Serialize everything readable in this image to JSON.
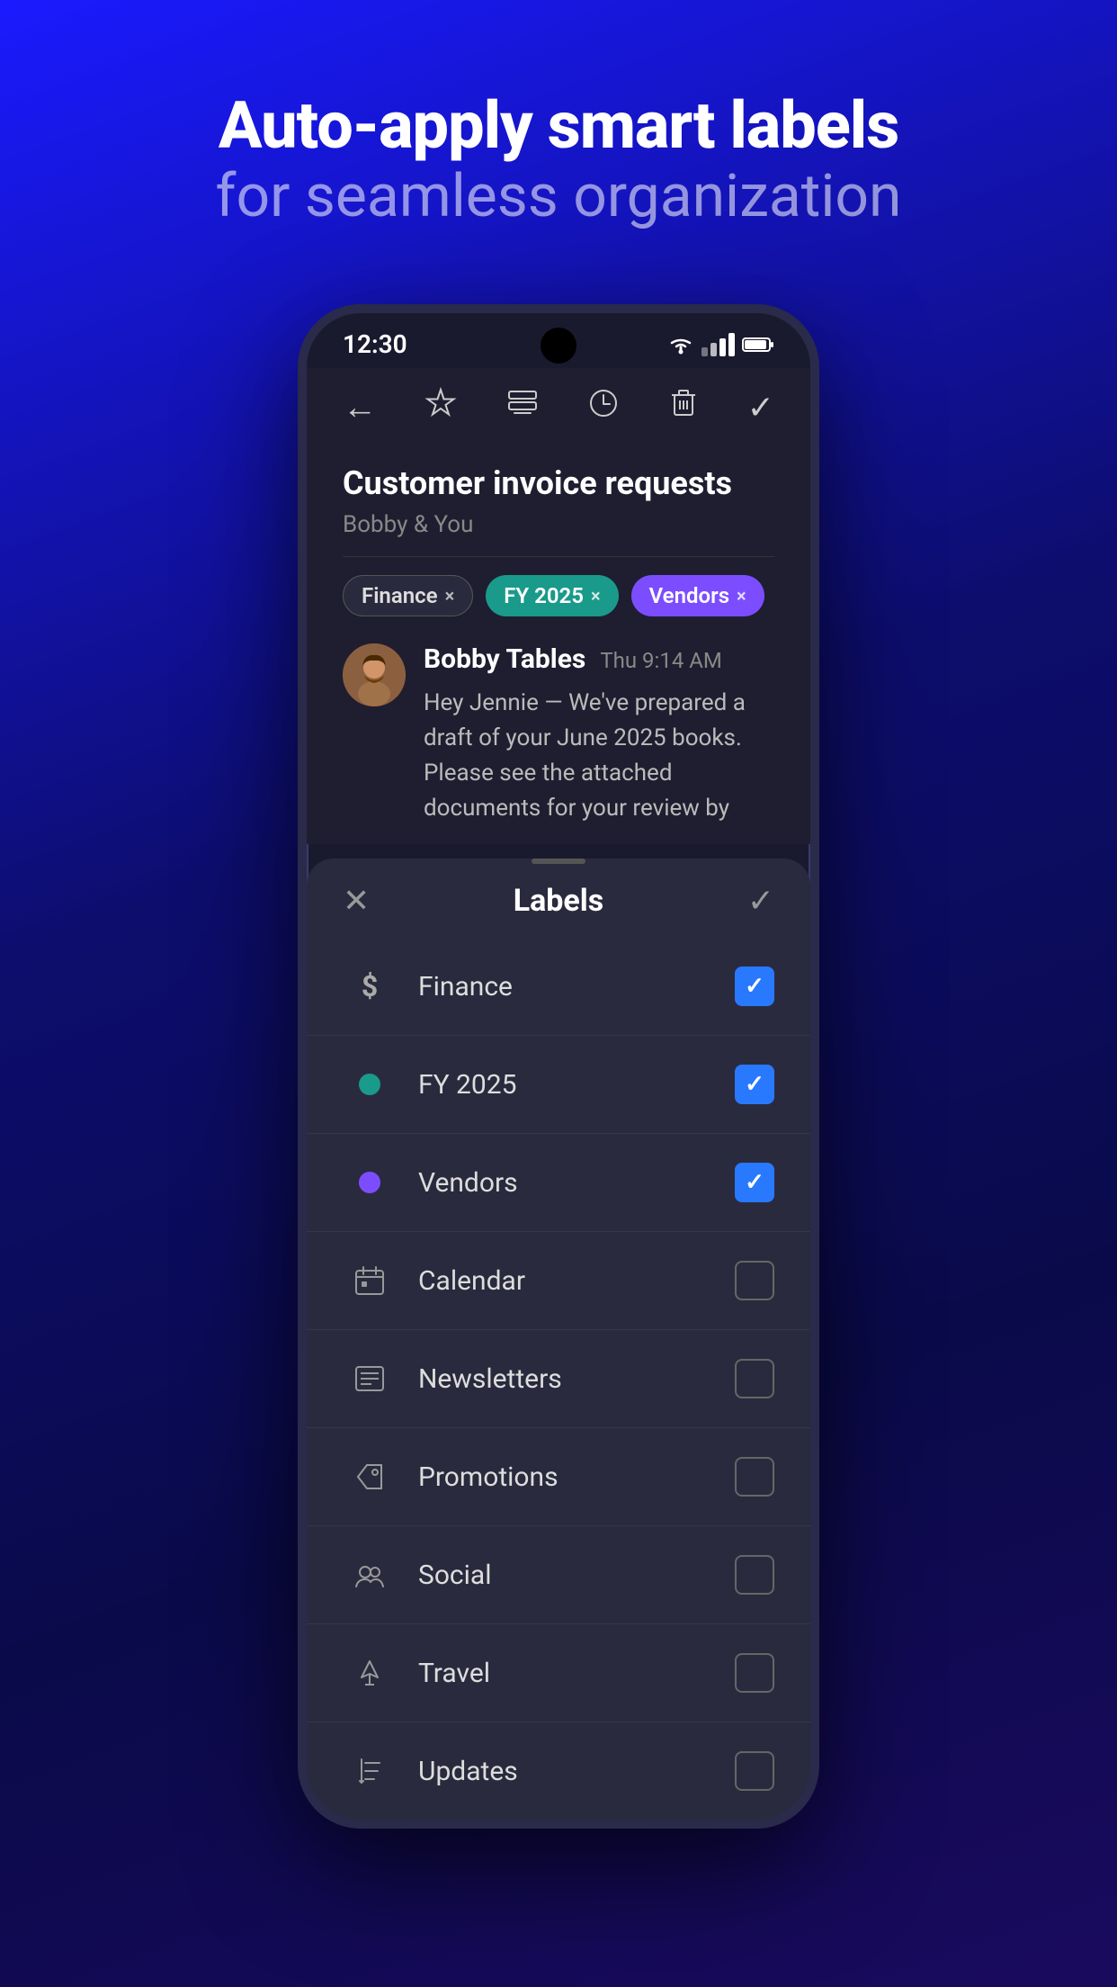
{
  "hero": {
    "title": "Auto-apply smart labels",
    "subtitle": "for seamless organization"
  },
  "phone": {
    "status": {
      "time": "12:30"
    },
    "toolbar": {
      "back_label": "←",
      "star_label": "☆",
      "label_label": "⊟",
      "clock_label": "⏱",
      "trash_label": "🗑",
      "check_label": "✓"
    },
    "email": {
      "subject": "Customer invoice requests",
      "participants": "Bobby & You",
      "tags": [
        {
          "id": "finance",
          "label": "Finance",
          "style": "finance"
        },
        {
          "id": "fy2025",
          "label": "FY 2025",
          "style": "fy2025"
        },
        {
          "id": "vendors",
          "label": "Vendors",
          "style": "vendors"
        }
      ],
      "sender_name": "Bobby Tables",
      "message_time": "Thu 9:14 AM",
      "message_text": "Hey Jennie — We've prepared a draft of your June 2025 books. Please see the attached documents for your review by"
    },
    "labels_panel": {
      "title": "Labels",
      "items": [
        {
          "id": "finance",
          "name": "Finance",
          "icon_type": "dollar",
          "checked": true
        },
        {
          "id": "fy2025",
          "name": "FY 2025",
          "icon_type": "dot-teal",
          "checked": true
        },
        {
          "id": "vendors",
          "name": "Vendors",
          "icon_type": "dot-purple",
          "checked": true
        },
        {
          "id": "calendar",
          "name": "Calendar",
          "icon_type": "calendar",
          "checked": false
        },
        {
          "id": "newsletters",
          "name": "Newsletters",
          "icon_type": "newsletter",
          "checked": false
        },
        {
          "id": "promotions",
          "name": "Promotions",
          "icon_type": "tag",
          "checked": false
        },
        {
          "id": "social",
          "name": "Social",
          "icon_type": "social",
          "checked": false
        },
        {
          "id": "travel",
          "name": "Travel",
          "icon_type": "travel",
          "checked": false
        },
        {
          "id": "updates",
          "name": "Updates",
          "icon_type": "flag",
          "checked": false
        }
      ]
    }
  }
}
